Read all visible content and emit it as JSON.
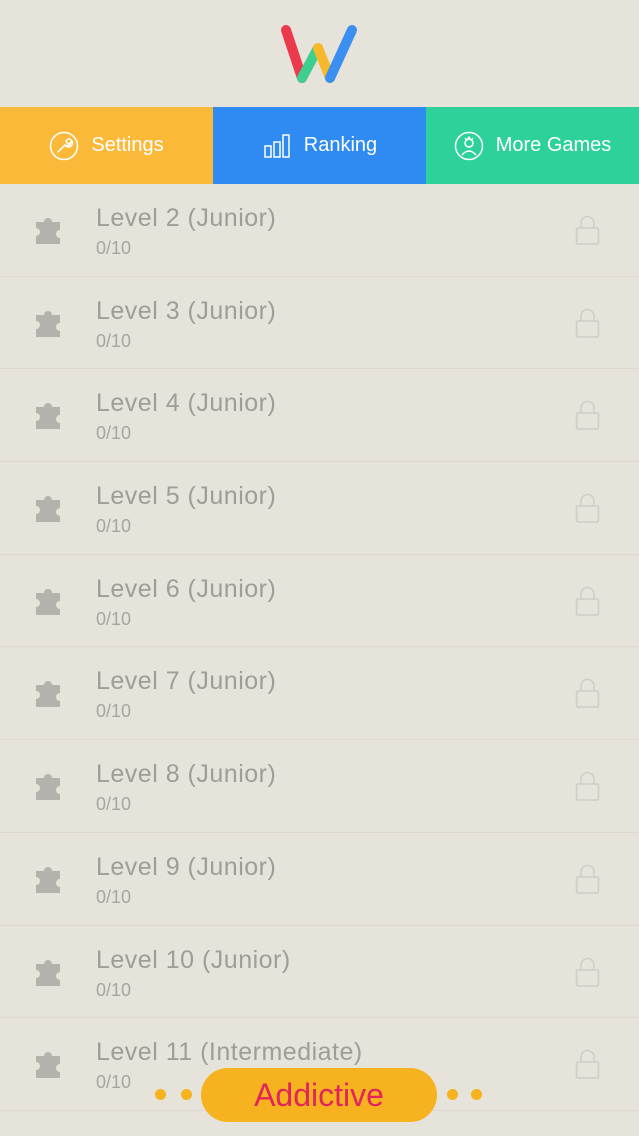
{
  "tabs": [
    {
      "label": "Settings",
      "color": "#fbb93a",
      "icon": "wrench-icon"
    },
    {
      "label": "Ranking",
      "color": "#2f8bf2",
      "icon": "ranking-bars-icon"
    },
    {
      "label": "More Games",
      "color": "#2fd19a",
      "icon": "person-icon"
    }
  ],
  "levels": [
    {
      "title": "Level 2 (Junior)",
      "progress": "0/10"
    },
    {
      "title": "Level 3 (Junior)",
      "progress": "0/10"
    },
    {
      "title": "Level 4 (Junior)",
      "progress": "0/10"
    },
    {
      "title": "Level 5 (Junior)",
      "progress": "0/10"
    },
    {
      "title": "Level 6 (Junior)",
      "progress": "0/10"
    },
    {
      "title": "Level 7 (Junior)",
      "progress": "0/10"
    },
    {
      "title": "Level 8 (Junior)",
      "progress": "0/10"
    },
    {
      "title": "Level 9 (Junior)",
      "progress": "0/10"
    },
    {
      "title": "Level 10 (Junior)",
      "progress": "0/10"
    },
    {
      "title": "Level 11 (Intermediate)",
      "progress": "0/10"
    }
  ],
  "banner": {
    "label": "Addictive"
  },
  "colors": {
    "background": "#e6e3db",
    "text_muted": "#9e9d98",
    "banner": "#f6b21f",
    "banner_text": "#e3245a",
    "logo_red": "#ea3a4b",
    "logo_green": "#3ecf8e",
    "logo_yellow": "#f7b82c",
    "logo_blue": "#3a8ff0"
  }
}
